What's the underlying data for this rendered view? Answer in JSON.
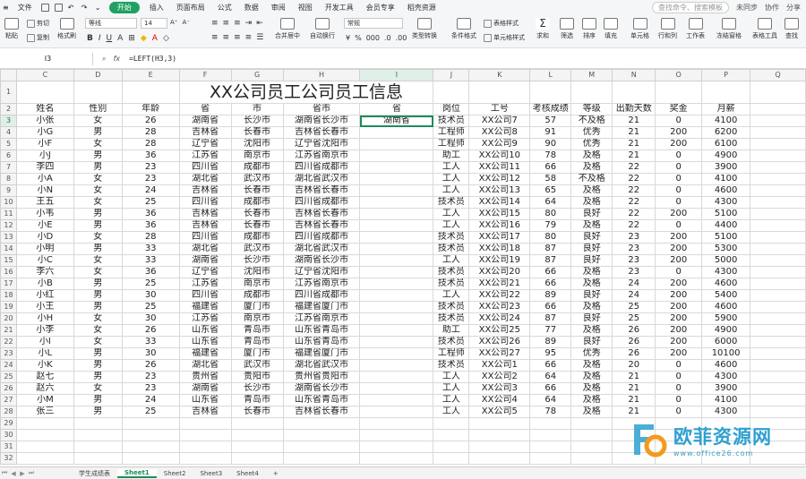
{
  "menubar": {
    "file": "文件",
    "tabs": [
      "开始",
      "插入",
      "页面布局",
      "公式",
      "数据",
      "审阅",
      "视图",
      "开发工具",
      "会员专享",
      "稻壳资源"
    ],
    "active": "开始",
    "search_placeholder": "查找命令、搜索模板",
    "right_items": [
      "未同步",
      "协作",
      "分享"
    ]
  },
  "ribbon": {
    "paste": "粘贴",
    "cut": "剪切",
    "copy": "复制",
    "format_painter": "格式刷",
    "font_name": "等线",
    "font_size": "14",
    "merge_center": "合并居中",
    "wrap": "自动换行",
    "number_format": "常规",
    "type_convert": "类型转换",
    "cond_format": "条件格式",
    "table_style": "表格样式",
    "cell_style": "单元格样式",
    "sum": "求和",
    "filter": "筛选",
    "sort": "排序",
    "fill": "填充",
    "cell": "单元格",
    "row_col": "行和列",
    "worksheet": "工作表",
    "freeze": "冻结窗格",
    "table_tools": "表格工具",
    "find": "查找"
  },
  "formula_bar": {
    "cell_ref": "I3",
    "fx": "fx",
    "formula": "=LEFT(H3,3)"
  },
  "sheet": {
    "columns": [
      "C",
      "D",
      "E",
      "F",
      "G",
      "H",
      "I",
      "J",
      "K",
      "L",
      "M",
      "N",
      "O",
      "P",
      "Q"
    ],
    "row_numbers": [
      "1",
      "2",
      "3",
      "4",
      "5",
      "6",
      "7",
      "8",
      "9",
      "10",
      "11",
      "12",
      "13",
      "14",
      "15",
      "16",
      "17",
      "18",
      "19",
      "20",
      "21",
      "22",
      "23",
      "24",
      "25",
      "26",
      "27",
      "28",
      "29",
      "30",
      "31",
      "32"
    ],
    "title": "XX公司员工公司员工信息",
    "headers": [
      "姓名",
      "性别",
      "年龄",
      "省",
      "市",
      "省市",
      "省",
      "岗位",
      "工号",
      "考核成绩",
      "等级",
      "出勤天数",
      "奖金",
      "月薪"
    ],
    "rows": [
      [
        "小张",
        "女",
        "26",
        "湖南省",
        "长沙市",
        "湖南省长沙市",
        "湖南省",
        "技术员",
        "XX公司7",
        "57",
        "不及格",
        "21",
        "0",
        "4100"
      ],
      [
        "小G",
        "男",
        "28",
        "吉林省",
        "长春市",
        "吉林省长春市",
        "",
        "工程师",
        "XX公司8",
        "91",
        "优秀",
        "21",
        "200",
        "6200"
      ],
      [
        "小F",
        "女",
        "28",
        "辽宁省",
        "沈阳市",
        "辽宁省沈阳市",
        "",
        "工程师",
        "XX公司9",
        "90",
        "优秀",
        "21",
        "200",
        "6100"
      ],
      [
        "小J",
        "男",
        "36",
        "江苏省",
        "南京市",
        "江苏省南京市",
        "",
        "助工",
        "XX公司10",
        "78",
        "及格",
        "21",
        "0",
        "4900"
      ],
      [
        "李四",
        "男",
        "23",
        "四川省",
        "成都市",
        "四川省成都市",
        "",
        "工人",
        "XX公司11",
        "66",
        "及格",
        "22",
        "0",
        "3900"
      ],
      [
        "小A",
        "女",
        "23",
        "湖北省",
        "武汉市",
        "湖北省武汉市",
        "",
        "工人",
        "XX公司12",
        "58",
        "不及格",
        "22",
        "0",
        "4100"
      ],
      [
        "小N",
        "女",
        "24",
        "吉林省",
        "长春市",
        "吉林省长春市",
        "",
        "工人",
        "XX公司13",
        "65",
        "及格",
        "22",
        "0",
        "4600"
      ],
      [
        "王五",
        "女",
        "25",
        "四川省",
        "成都市",
        "四川省成都市",
        "",
        "技术员",
        "XX公司14",
        "64",
        "及格",
        "22",
        "0",
        "4300"
      ],
      [
        "小韦",
        "男",
        "36",
        "吉林省",
        "长春市",
        "吉林省长春市",
        "",
        "工人",
        "XX公司15",
        "80",
        "良好",
        "22",
        "200",
        "5100"
      ],
      [
        "小E",
        "男",
        "36",
        "吉林省",
        "长春市",
        "吉林省长春市",
        "",
        "工人",
        "XX公司16",
        "79",
        "及格",
        "22",
        "0",
        "4400"
      ],
      [
        "小D",
        "女",
        "28",
        "四川省",
        "成都市",
        "四川省成都市",
        "",
        "技术员",
        "XX公司17",
        "80",
        "良好",
        "23",
        "200",
        "5100"
      ],
      [
        "小明",
        "男",
        "33",
        "湖北省",
        "武汉市",
        "湖北省武汉市",
        "",
        "技术员",
        "XX公司18",
        "87",
        "良好",
        "23",
        "200",
        "5300"
      ],
      [
        "小C",
        "女",
        "33",
        "湖南省",
        "长沙市",
        "湖南省长沙市",
        "",
        "工人",
        "XX公司19",
        "87",
        "良好",
        "23",
        "200",
        "5000"
      ],
      [
        "李六",
        "女",
        "36",
        "辽宁省",
        "沈阳市",
        "辽宁省沈阳市",
        "",
        "技术员",
        "XX公司20",
        "66",
        "及格",
        "23",
        "0",
        "4300"
      ],
      [
        "小B",
        "男",
        "25",
        "江苏省",
        "南京市",
        "江苏省南京市",
        "",
        "技术员",
        "XX公司21",
        "66",
        "及格",
        "24",
        "200",
        "4600"
      ],
      [
        "小红",
        "男",
        "30",
        "四川省",
        "成都市",
        "四川省成都市",
        "",
        "工人",
        "XX公司22",
        "89",
        "良好",
        "24",
        "200",
        "5400"
      ],
      [
        "小王",
        "男",
        "25",
        "福建省",
        "厦门市",
        "福建省厦门市",
        "",
        "技术员",
        "XX公司23",
        "66",
        "及格",
        "25",
        "200",
        "4600"
      ],
      [
        "小H",
        "女",
        "30",
        "江苏省",
        "南京市",
        "江苏省南京市",
        "",
        "技术员",
        "XX公司24",
        "87",
        "良好",
        "25",
        "200",
        "5900"
      ],
      [
        "小李",
        "女",
        "26",
        "山东省",
        "青岛市",
        "山东省青岛市",
        "",
        "助工",
        "XX公司25",
        "77",
        "及格",
        "26",
        "200",
        "4900"
      ],
      [
        "小I",
        "女",
        "33",
        "山东省",
        "青岛市",
        "山东省青岛市",
        "",
        "技术员",
        "XX公司26",
        "89",
        "良好",
        "26",
        "200",
        "6000"
      ],
      [
        "小L",
        "男",
        "30",
        "福建省",
        "厦门市",
        "福建省厦门市",
        "",
        "工程师",
        "XX公司27",
        "95",
        "优秀",
        "26",
        "200",
        "10100"
      ],
      [
        "小K",
        "男",
        "26",
        "湖北省",
        "武汉市",
        "湖北省武汉市",
        "",
        "技术员",
        "XX公司1",
        "66",
        "及格",
        "20",
        "0",
        "4600"
      ],
      [
        "赵七",
        "男",
        "23",
        "贵州省",
        "贵阳市",
        "贵州省贵阳市",
        "",
        "工人",
        "XX公司2",
        "64",
        "及格",
        "21",
        "0",
        "4300"
      ],
      [
        "赵六",
        "女",
        "23",
        "湖南省",
        "长沙市",
        "湖南省长沙市",
        "",
        "工人",
        "XX公司3",
        "66",
        "及格",
        "21",
        "0",
        "3900"
      ],
      [
        "小M",
        "男",
        "24",
        "山东省",
        "青岛市",
        "山东省青岛市",
        "",
        "工人",
        "XX公司4",
        "64",
        "及格",
        "21",
        "0",
        "4100"
      ],
      [
        "张三",
        "男",
        "25",
        "吉林省",
        "长春市",
        "吉林省长春市",
        "",
        "工人",
        "XX公司5",
        "78",
        "及格",
        "21",
        "0",
        "4300"
      ]
    ]
  },
  "tabs": [
    "学生成绩表",
    "Sheet1",
    "Sheet2",
    "Sheet3",
    "Sheet4"
  ],
  "active_tab": "Sheet1",
  "add_sheet": "+",
  "watermark": {
    "brand": "欧菲资源网",
    "url": "www.office26.com"
  },
  "colors": {
    "accent": "#1e8c5a",
    "active_tab_green": "#20a162",
    "watermark_blue": "#2da0d0"
  }
}
